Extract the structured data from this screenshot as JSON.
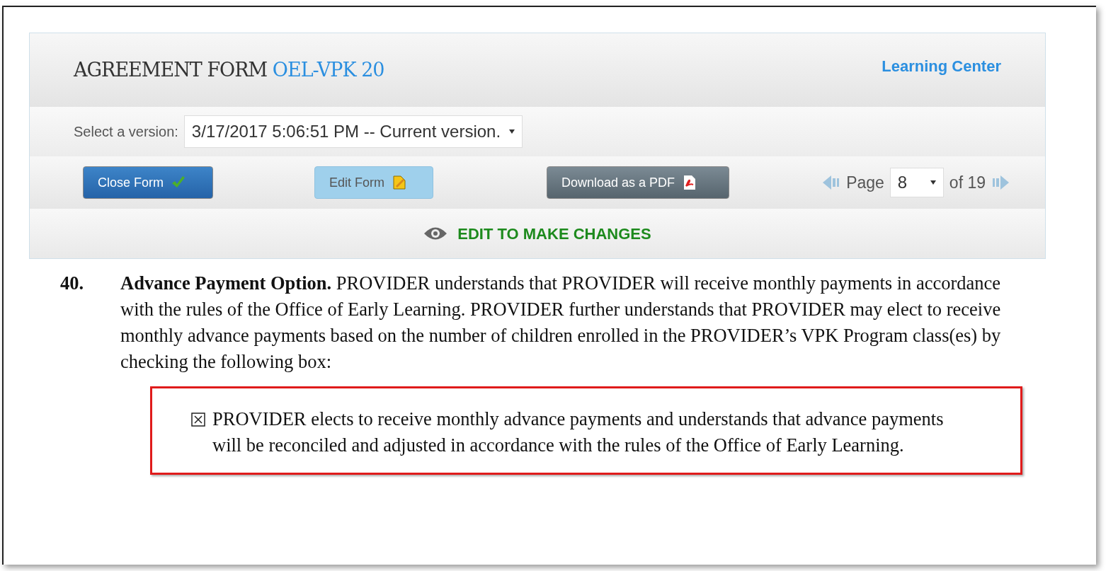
{
  "header": {
    "title": "AGREEMENT FORM",
    "code": "OEL-VPK 20",
    "organization": "Learning Center"
  },
  "version": {
    "label": "Select a version:",
    "value": "3/17/2017 5:06:51 PM -- Current version."
  },
  "buttons": [
    {
      "label": "Close Form",
      "kind": "close"
    },
    {
      "label": "Edit Form",
      "kind": "edit"
    },
    {
      "label": "Download as a PDF",
      "kind": "pdf"
    }
  ],
  "pager": {
    "label": "Page",
    "value": "8",
    "total": "of 19"
  },
  "notice": "EDIT TO MAKE CHANGES",
  "clause": {
    "number": "40.",
    "text": "**Advance Payment Option.** PROVIDER understands that PROVIDER will receive monthly payments in accordance with the rules of the Office of Early Learning. PROVIDER further understands that PROVIDER may elect to receive monthly advance payments based on the number of children enrolled in the PROVIDER’s VPK Program class(es) by checking the following box:",
    "option": {
      "checked": true,
      "text": "PROVIDER elects to receive monthly advance payments and understands that advance payments will be reconciled and adjusted in accordance with the rules of the Office of Early Learning."
    }
  }
}
